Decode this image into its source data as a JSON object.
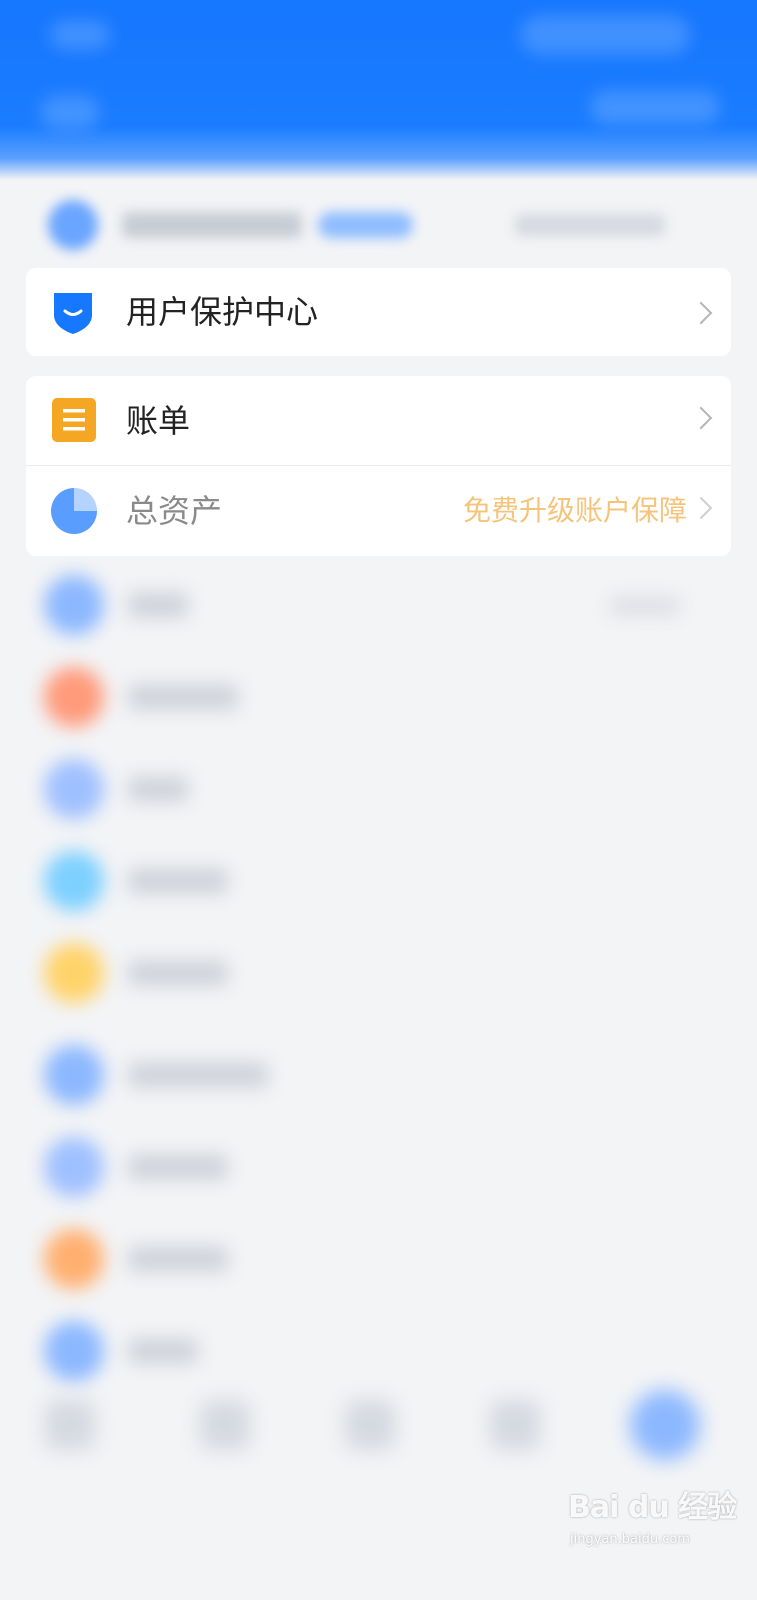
{
  "menu": {
    "user_protection": {
      "icon": "shield-icon",
      "label": "用户保护中心"
    },
    "bill": {
      "icon": "bill-icon",
      "label": "账单"
    },
    "total_assets": {
      "icon": "pie-chart-icon",
      "label": "总资产",
      "promo": "免费升级账户保障"
    }
  },
  "colors": {
    "header_blue": "#1677ff",
    "shield_blue": "#1677ff",
    "bill_orange": "#f5a623",
    "pie_blue": "#3c8cff",
    "promo_text": "#f5c47a"
  },
  "watermark": {
    "logo": "Bai du 经验",
    "url": "jingyan.baidu.com"
  }
}
